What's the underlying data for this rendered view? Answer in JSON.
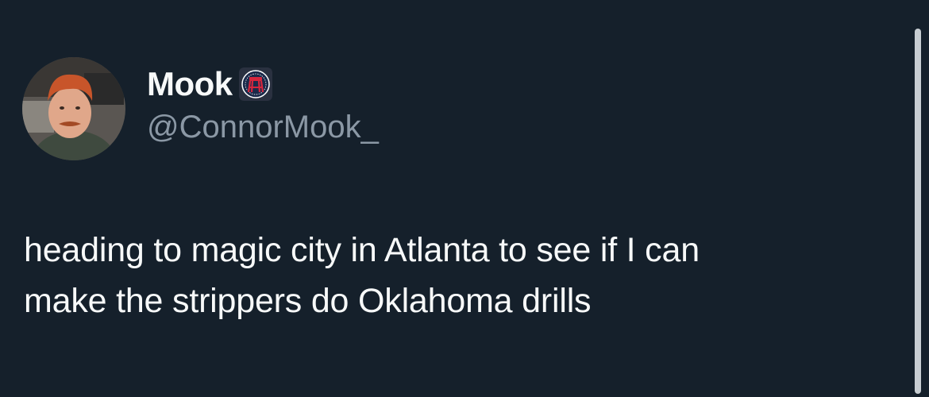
{
  "tweet": {
    "author": {
      "display_name": "Mook",
      "handle": "@ConnorMook_",
      "avatar_icon": "profile-photo",
      "badge_icon": "barstool-sports-affiliate-badge"
    },
    "text_lines": [
      "heading to magic city in Atlanta to see if I can",
      "make the strippers do Oklahoma drills"
    ]
  },
  "colors": {
    "background": "#15202b",
    "text_primary": "#f7f9f9",
    "text_secondary": "#8b98a5",
    "badge_red": "#d7263d",
    "badge_navy": "#1b2a4a",
    "scrollbar": "#c7cdd2"
  }
}
